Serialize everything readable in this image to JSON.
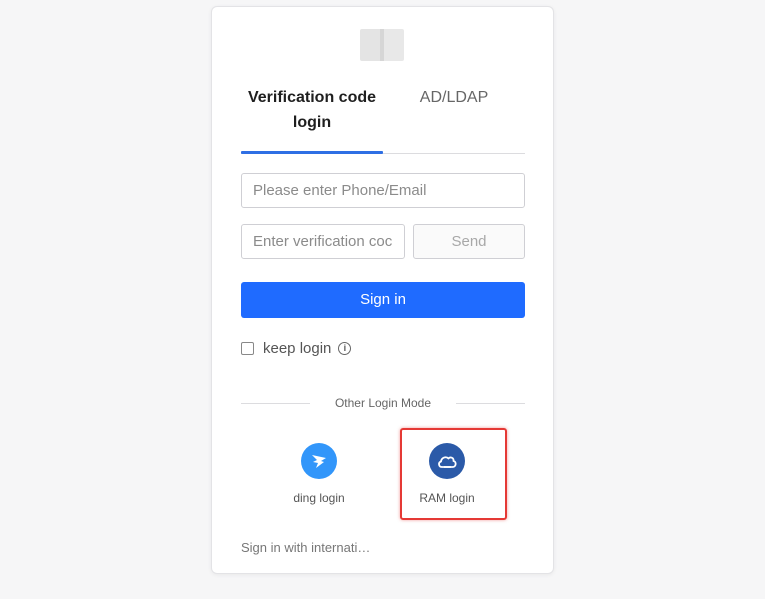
{
  "tabs": [
    {
      "label": "Verification code\nlogin",
      "active": true
    },
    {
      "label": "AD/LDAP",
      "active": false
    }
  ],
  "phone_input": {
    "placeholder": "Please enter Phone/Email",
    "value": ""
  },
  "code_input": {
    "placeholder": "Enter verification coc",
    "value": ""
  },
  "send_label": "Send",
  "signin_label": "Sign in",
  "keep_login": {
    "label": "keep login",
    "checked": false
  },
  "other_login_mode": "Other Login Mode",
  "modes": [
    {
      "label": "ding login",
      "icon": "dingtalk-icon",
      "color": "#3296fa"
    },
    {
      "label": "RAM login",
      "icon": "cloud-icon",
      "color": "#2b5aa8"
    }
  ],
  "international_link": "Sign in with internati…",
  "colors": {
    "accent": "#1f6bff",
    "tab_ink": "#2f6fe4",
    "highlight": "#e53935"
  }
}
